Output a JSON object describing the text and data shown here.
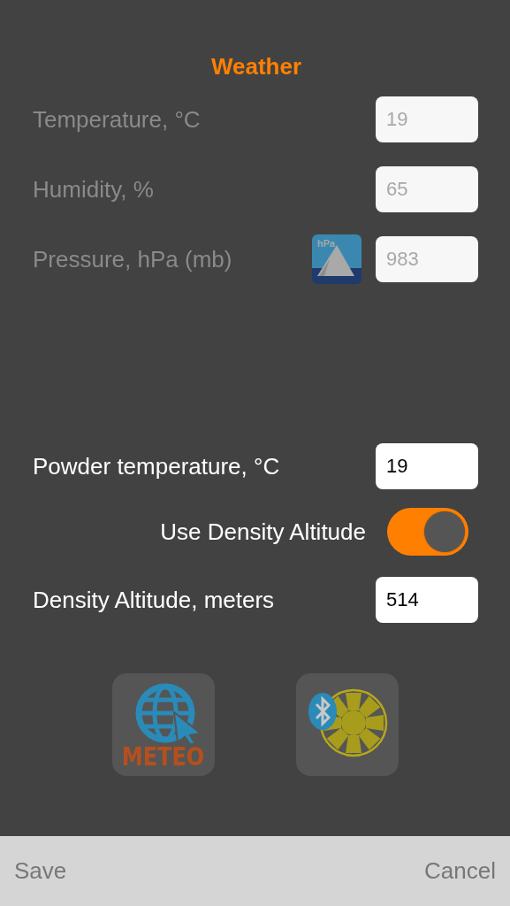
{
  "title": "Weather",
  "rows": [
    {
      "kind": "field",
      "label": "Temperature, °C",
      "value": "19",
      "disabled": true
    },
    {
      "kind": "field",
      "label": "Humidity, %",
      "value": "65",
      "disabled": true
    },
    {
      "kind": "field",
      "label": "Pressure, hPa (mb)",
      "value": "983",
      "disabled": true,
      "badge": "hPa"
    },
    {
      "kind": "spacer"
    },
    {
      "kind": "field",
      "label": "Powder temperature, °C",
      "value": "19",
      "disabled": false
    },
    {
      "kind": "toggle",
      "label": "Use Density Altitude",
      "on": true
    },
    {
      "kind": "field",
      "label": "Density Altitude, meters",
      "value": "514",
      "disabled": false
    }
  ],
  "tools": [
    {
      "kind": "meteo",
      "label": "METEO"
    },
    {
      "kind": "bluetooth-fan"
    }
  ],
  "bottom_bar": {
    "left": "Save",
    "right": "Cancel"
  }
}
